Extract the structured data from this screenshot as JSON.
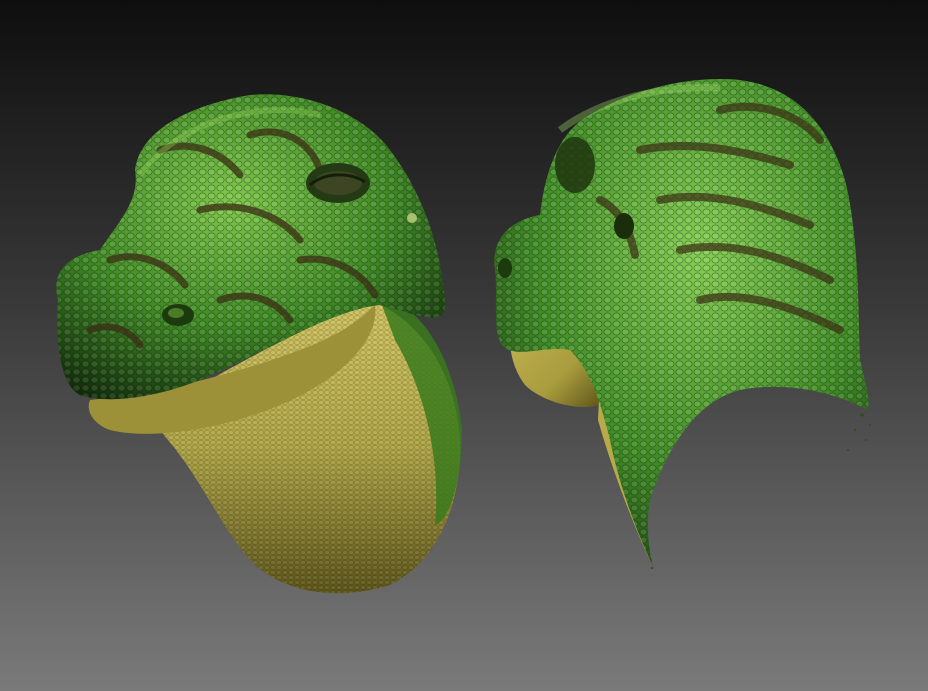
{
  "viewport": {
    "background_top": "#0e0e0e",
    "background_bottom": "#7a7a7a"
  },
  "models": [
    {
      "name": "creature-head-three-quarter-view",
      "skin_color": "#3d8a22",
      "skin_highlight": "#7fc94a",
      "belly_color": "#b0a546",
      "stripe_color": "#3a2e14"
    },
    {
      "name": "creature-head-back-three-quarter-view",
      "skin_color": "#3f8e24",
      "skin_highlight": "#86d052",
      "belly_color": "#a99c3e",
      "stripe_color": "#3a2e14"
    }
  ]
}
